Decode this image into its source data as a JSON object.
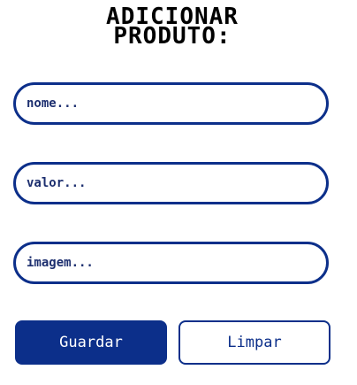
{
  "form": {
    "title_line1": "ADICIONAR",
    "title_line2": "PRODUTO:",
    "fields": {
      "name_placeholder": "nome...",
      "price_placeholder": "valor...",
      "image_placeholder": "imagem..."
    },
    "buttons": {
      "save_label": "Guardar",
      "clear_label": "Limpar"
    }
  },
  "colors": {
    "primary": "#0c2f8a",
    "title": "#000000",
    "background": "#ffffff"
  }
}
